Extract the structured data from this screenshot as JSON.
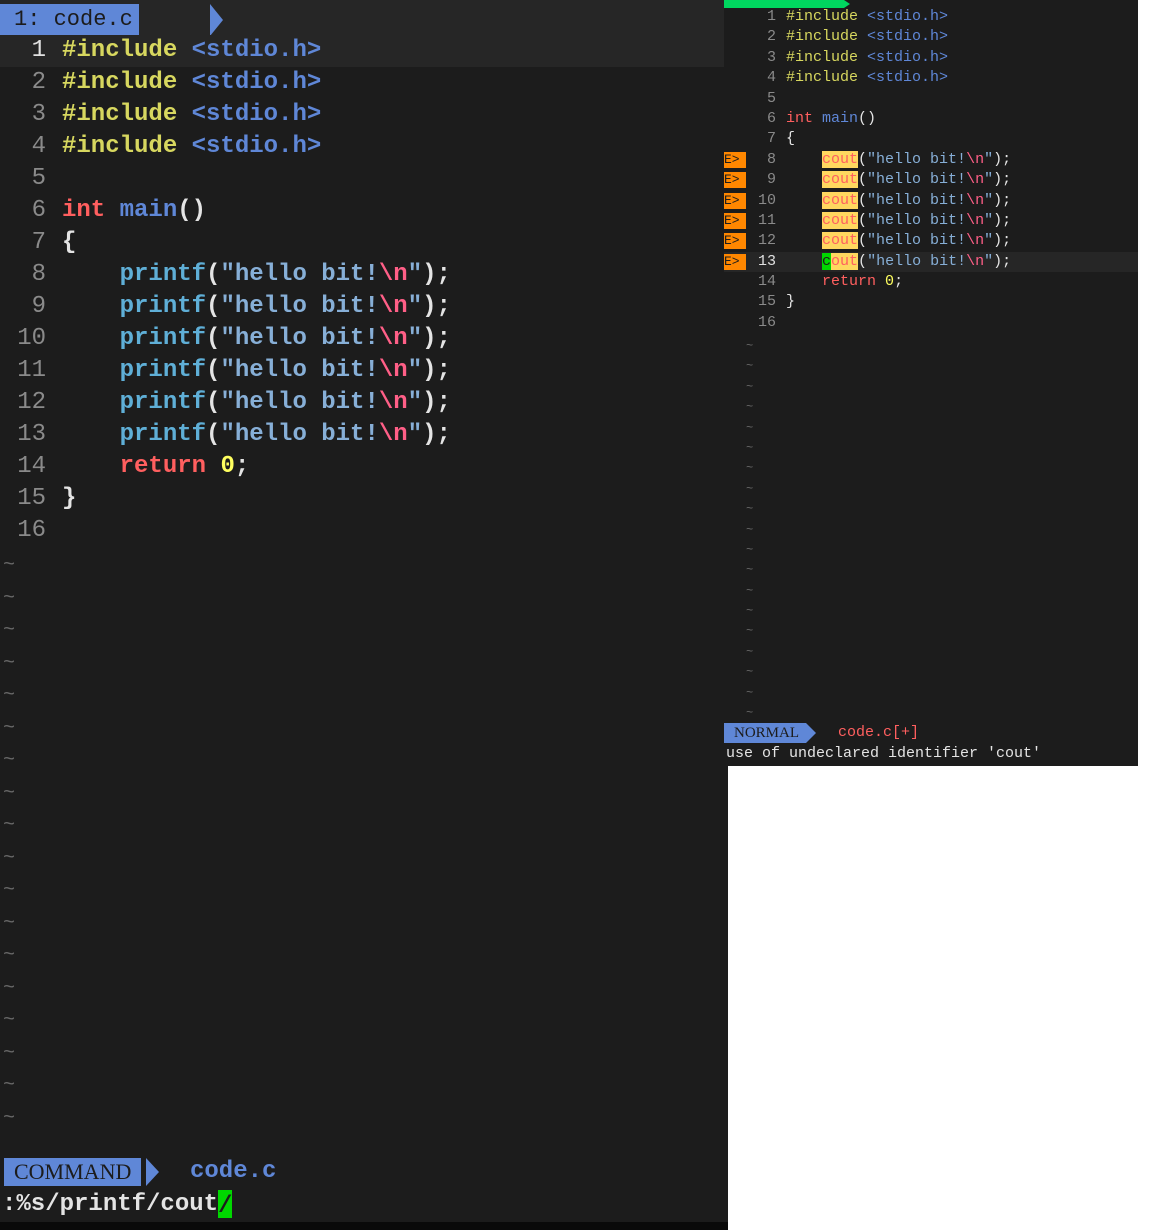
{
  "left_editor": {
    "tab_label": "1: code.c",
    "lines": [
      {
        "n": "1",
        "include": "#include",
        "header": "<stdio.h>"
      },
      {
        "n": "2",
        "include": "#include",
        "header": "<stdio.h>"
      },
      {
        "n": "3",
        "include": "#include",
        "header": "<stdio.h>"
      },
      {
        "n": "4",
        "include": "#include",
        "header": "<stdio.h>"
      },
      {
        "n": "5"
      },
      {
        "n": "6",
        "type": "int",
        "func": "main",
        "paren": "()"
      },
      {
        "n": "7",
        "brace": "{"
      },
      {
        "n": "8",
        "call": "printf",
        "open": "(",
        "str": "\"hello bit!",
        "esc": "\\n",
        "strend": "\"",
        "close": ");"
      },
      {
        "n": "9",
        "call": "printf",
        "open": "(",
        "str": "\"hello bit!",
        "esc": "\\n",
        "strend": "\"",
        "close": ");"
      },
      {
        "n": "10",
        "call": "printf",
        "open": "(",
        "str": "\"hello bit!",
        "esc": "\\n",
        "strend": "\"",
        "close": ");"
      },
      {
        "n": "11",
        "call": "printf",
        "open": "(",
        "str": "\"hello bit!",
        "esc": "\\n",
        "strend": "\"",
        "close": ");"
      },
      {
        "n": "12",
        "call": "printf",
        "open": "(",
        "str": "\"hello bit!",
        "esc": "\\n",
        "strend": "\"",
        "close": ");"
      },
      {
        "n": "13",
        "call": "printf",
        "open": "(",
        "str": "\"hello bit!",
        "esc": "\\n",
        "strend": "\"",
        "close": ");"
      },
      {
        "n": "14",
        "ret": "return",
        "num": "0",
        "semi": ";"
      },
      {
        "n": "15",
        "brace": "}"
      },
      {
        "n": "16"
      }
    ],
    "tilde": "~",
    "mode": "COMMAND",
    "status_file": "code.c",
    "command": ":%s/printf/cout",
    "command_cursor": "/"
  },
  "right_editor": {
    "lines": [
      {
        "n": "1",
        "include": "#include",
        "header": "<stdio.h>"
      },
      {
        "n": "2",
        "include": "#include",
        "header": "<stdio.h>"
      },
      {
        "n": "3",
        "include": "#include",
        "header": "<stdio.h>"
      },
      {
        "n": "4",
        "include": "#include",
        "header": "<stdio.h>"
      },
      {
        "n": "5"
      },
      {
        "n": "6",
        "type": "int",
        "func": "main",
        "paren": "()"
      },
      {
        "n": "7",
        "brace": "{"
      },
      {
        "n": "8",
        "sign": "E>",
        "call": "cout",
        "open": "(",
        "str": "\"hello bit!",
        "esc": "\\n",
        "strend": "\"",
        "close": ");"
      },
      {
        "n": "9",
        "sign": "E>",
        "call": "cout",
        "open": "(",
        "str": "\"hello bit!",
        "esc": "\\n",
        "strend": "\"",
        "close": ");"
      },
      {
        "n": "10",
        "sign": "E>",
        "call": "cout",
        "open": "(",
        "str": "\"hello bit!",
        "esc": "\\n",
        "strend": "\"",
        "close": ");"
      },
      {
        "n": "11",
        "sign": "E>",
        "call": "cout",
        "open": "(",
        "str": "\"hello bit!",
        "esc": "\\n",
        "strend": "\"",
        "close": ");"
      },
      {
        "n": "12",
        "sign": "E>",
        "call": "cout",
        "open": "(",
        "str": "\"hello bit!",
        "esc": "\\n",
        "strend": "\"",
        "close": ");"
      },
      {
        "n": "13",
        "sign": "E>",
        "call_first": "c",
        "call_rest": "out",
        "open": "(",
        "str": "\"hello bit!",
        "esc": "\\n",
        "strend": "\"",
        "close": ");"
      },
      {
        "n": "14",
        "ret": "return",
        "num": "0",
        "semi": ";"
      },
      {
        "n": "15",
        "brace": "}"
      },
      {
        "n": "16"
      }
    ],
    "tilde": "~",
    "mode": "NORMAL",
    "status_file": "code.c[+]",
    "message": "use of undeclared identifier 'cout'"
  },
  "colors": {
    "background": "#1c1c1c",
    "mode_accent": "#5f87d7",
    "error_sign": "#ff8700",
    "cursor": "#00d700"
  }
}
